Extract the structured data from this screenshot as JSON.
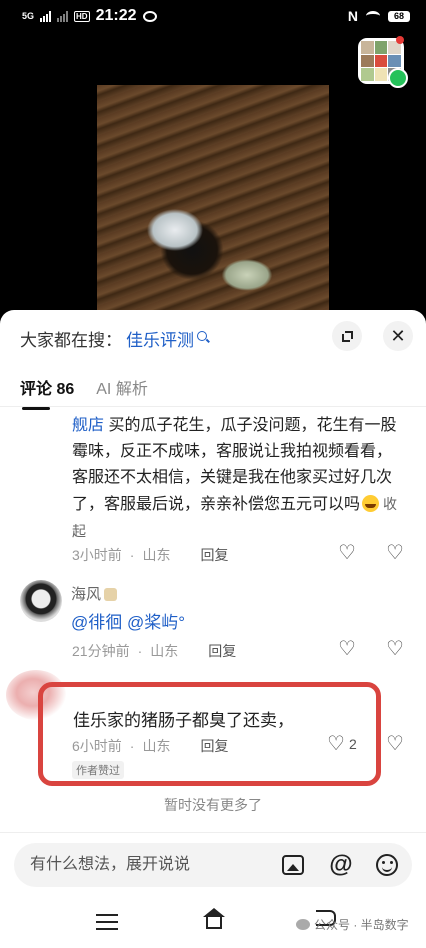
{
  "status_bar": {
    "network": "5G",
    "hd": "HD",
    "time": "21:22",
    "nfc": "N",
    "battery": "68"
  },
  "sheet": {
    "search_prefix": "大家都在搜：",
    "search_term": "佳乐评测",
    "tabs": [
      {
        "label": "评论 86",
        "active": true
      },
      {
        "label": "AI 解析",
        "active": false
      }
    ]
  },
  "comments": [
    {
      "mention_prefix": "舰店",
      "text": " 买的瓜子花生，瓜子没问题，花生有一股霉味，反正不成味，客服说让我拍视频看看，客服还不太相信，关键是我在他家买过好几次了，客服最后说，亲亲补偿您五元可以吗",
      "collapse_label": "收起",
      "time": "3小时前",
      "location": "山东",
      "reply_label": "回复"
    },
    {
      "username": "海风",
      "mentions": "@徘徊 @桨屿°",
      "time": "21分钟前",
      "location": "山东",
      "reply_label": "回复"
    },
    {
      "text": "佳乐家的猪肠子都臭了还卖，",
      "time": "6小时前",
      "location": "山东",
      "reply_label": "回复",
      "likes": "2",
      "badge": "作者赞过"
    }
  ],
  "no_more": "暂时没有更多了",
  "input": {
    "placeholder": "有什么想法，展开说说"
  },
  "watermark": "公众号 · 半岛数字",
  "colors": {
    "link": "#1f5fc7",
    "highlight": "#d9443f"
  },
  "icons": [
    "search-icon",
    "expand-icon",
    "close-icon",
    "heart-icon",
    "broken-heart-icon",
    "image-icon",
    "at-icon",
    "emoji-icon"
  ]
}
